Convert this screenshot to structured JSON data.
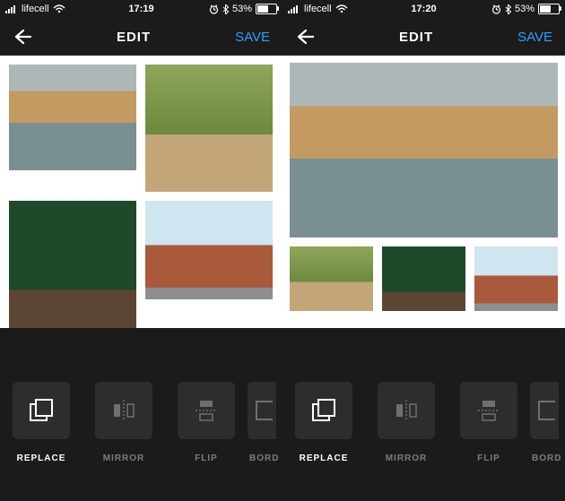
{
  "panes": [
    {
      "status": {
        "carrier": "lifecell",
        "time": "17:19",
        "battery_pct": "53%",
        "alarm": true,
        "bluetooth": true
      },
      "header": {
        "title": "EDIT",
        "save": "SAVE"
      },
      "layout": "grid-2x2",
      "images": [
        {
          "name": "river-buildings",
          "kind": "river"
        },
        {
          "name": "tree-lined-path",
          "kind": "trees"
        },
        {
          "name": "forest-tunnel",
          "kind": "forest"
        },
        {
          "name": "brick-building",
          "kind": "brick"
        }
      ],
      "tools": [
        {
          "id": "replace",
          "label": "REPLACE",
          "active": true
        },
        {
          "id": "mirror",
          "label": "MIRROR",
          "active": false
        },
        {
          "id": "flip",
          "label": "FLIP",
          "active": false
        },
        {
          "id": "border",
          "label": "BORDER",
          "active": false,
          "cut": true,
          "cut_label": "BORD"
        }
      ]
    },
    {
      "status": {
        "carrier": "lifecell",
        "time": "17:20",
        "battery_pct": "53%",
        "alarm": true,
        "bluetooth": true
      },
      "header": {
        "title": "EDIT",
        "save": "SAVE"
      },
      "layout": "hero-3",
      "images": [
        {
          "name": "river-buildings",
          "kind": "river"
        },
        {
          "name": "tree-lined-path",
          "kind": "trees"
        },
        {
          "name": "forest-tunnel",
          "kind": "forest"
        },
        {
          "name": "brick-building",
          "kind": "brick"
        }
      ],
      "tools": [
        {
          "id": "replace",
          "label": "REPLACE",
          "active": true
        },
        {
          "id": "mirror",
          "label": "MIRROR",
          "active": false
        },
        {
          "id": "flip",
          "label": "FLIP",
          "active": false
        },
        {
          "id": "border",
          "label": "BORDER",
          "active": false,
          "cut": true,
          "cut_label": "BORD"
        }
      ]
    }
  ],
  "icons": {
    "replace": "replace-icon",
    "mirror": "mirror-icon",
    "flip": "flip-icon",
    "border": "border-icon"
  }
}
